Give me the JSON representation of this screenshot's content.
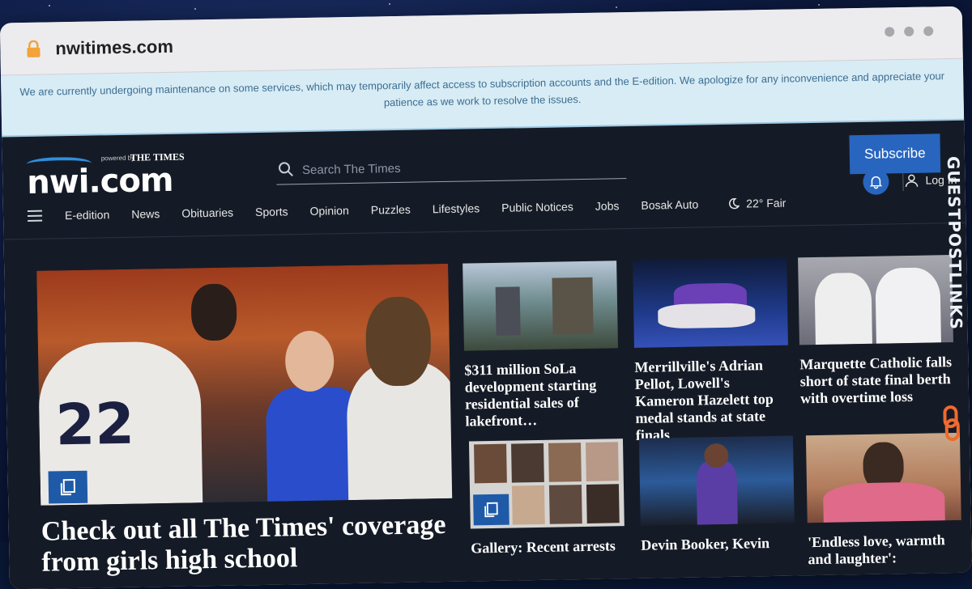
{
  "browser": {
    "url": "nwitimes.com"
  },
  "notice": {
    "text": "We are currently undergoing maintenance on some services, which may temporarily affect access to subscription accounts and the E-edition. We apologize for any inconvenience and appreciate your patience as we work to resolve the issues."
  },
  "header": {
    "logo_text": "nwi.com",
    "powered_by": "powered by",
    "times": "THE TIMES",
    "search_placeholder": "Search The Times",
    "subscribe_label": "Subscribe",
    "login_label": "Log In"
  },
  "nav": {
    "items": [
      "E-edition",
      "News",
      "Obituaries",
      "Sports",
      "Opinion",
      "Puzzles",
      "Lifestyles",
      "Public Notices",
      "Jobs",
      "Bosak Auto"
    ],
    "weather": "22° Fair"
  },
  "hero": {
    "headline": "Check out all The Times' coverage from girls high school"
  },
  "cards": [
    {
      "headline": "$311 million SoLa development starting residential sales of lakefront…"
    },
    {
      "headline": "Merrillville's Adrian Pellot, Lowell's Kameron Hazelett top medal stands at state finals"
    },
    {
      "headline": "Marquette Catholic falls short of state final berth with overtime loss"
    },
    {
      "headline": "Gallery: Recent arrests"
    },
    {
      "headline": "Devin Booker, Kevin"
    },
    {
      "headline": "'Endless love, warmth and laughter':"
    }
  ],
  "watermark": {
    "text": "GUESTPOSTLINKS"
  },
  "colors": {
    "accent": "#2865bf",
    "background": "#151b26",
    "notice_bg": "#d8ecf6"
  }
}
